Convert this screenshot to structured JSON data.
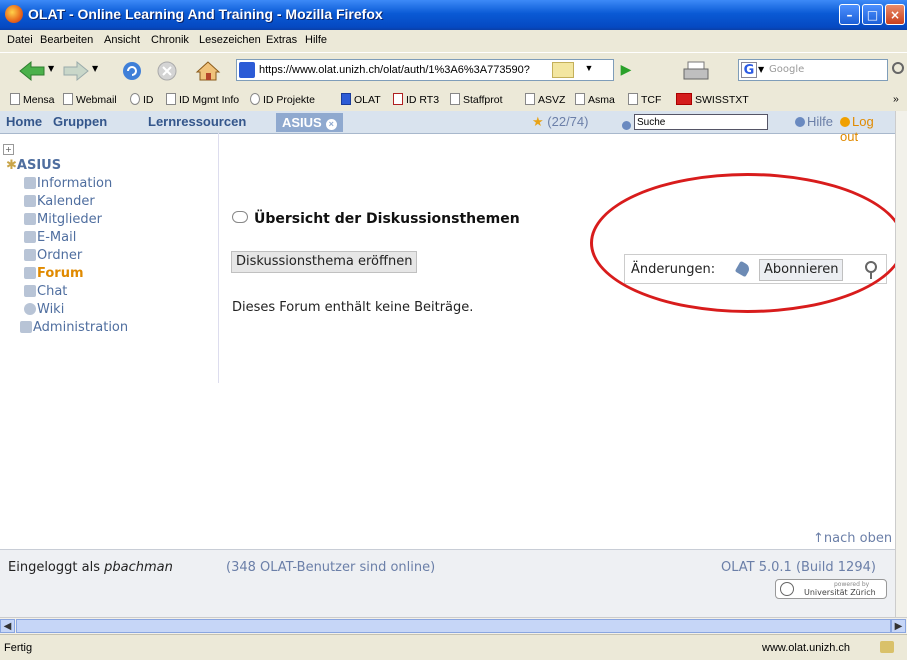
{
  "window": {
    "title": "OLAT - Online Learning And Training - Mozilla Firefox"
  },
  "menu": [
    "Datei",
    "Bearbeiten",
    "Ansicht",
    "Chronik",
    "Lesezeichen",
    "Extras",
    "Hilfe"
  ],
  "url": "https://www.olat.unizh.ch/olat/auth/1%3A6%3A773590?",
  "search_placeholder": "Google",
  "bookmarks": [
    "Mensa",
    "Webmail",
    "ID",
    "ID Mgmt Info",
    "ID Projekte",
    "OLAT",
    "ID RT3",
    "Staffprot",
    "ASVZ",
    "Asma",
    "TCF",
    "SWISSTXT"
  ],
  "olat": {
    "nav": [
      "Home",
      "Gruppen",
      "Lernressourcen"
    ],
    "active_tab": "ASIUS",
    "count": "(22/74)",
    "search_value": "Suche",
    "help": "Hilfe",
    "logout": "Log out"
  },
  "course": {
    "title": "ASIUS",
    "items": [
      "Information",
      "Kalender",
      "Mitglieder",
      "E-Mail",
      "Ordner",
      "Forum",
      "Chat",
      "Wiki",
      "Administration"
    ],
    "active": "Forum"
  },
  "forum": {
    "title": "Übersicht der Diskussionsthemen",
    "open_button": "Diskussionsthema eröffnen",
    "changes_label": "Änderungen:",
    "subscribe_button": "Abonnieren",
    "empty_message": "Dieses Forum enthält keine Beiträge.",
    "top_link": "↑nach oben"
  },
  "footer": {
    "logged_in_prefix": "Eingeloggt als ",
    "user": "pbachman",
    "online": "(348 OLAT-Benutzer sind online)",
    "version": "OLAT 5.0.1 (Build 1294)",
    "powered_by": "powered by",
    "university": "Universität Zürich"
  },
  "status": {
    "left": "Fertig",
    "right": "www.olat.unizh.ch"
  },
  "colors": {
    "link": "#4f6e9f",
    "annotation": "#d81c1c",
    "accent": "#e08a00"
  }
}
